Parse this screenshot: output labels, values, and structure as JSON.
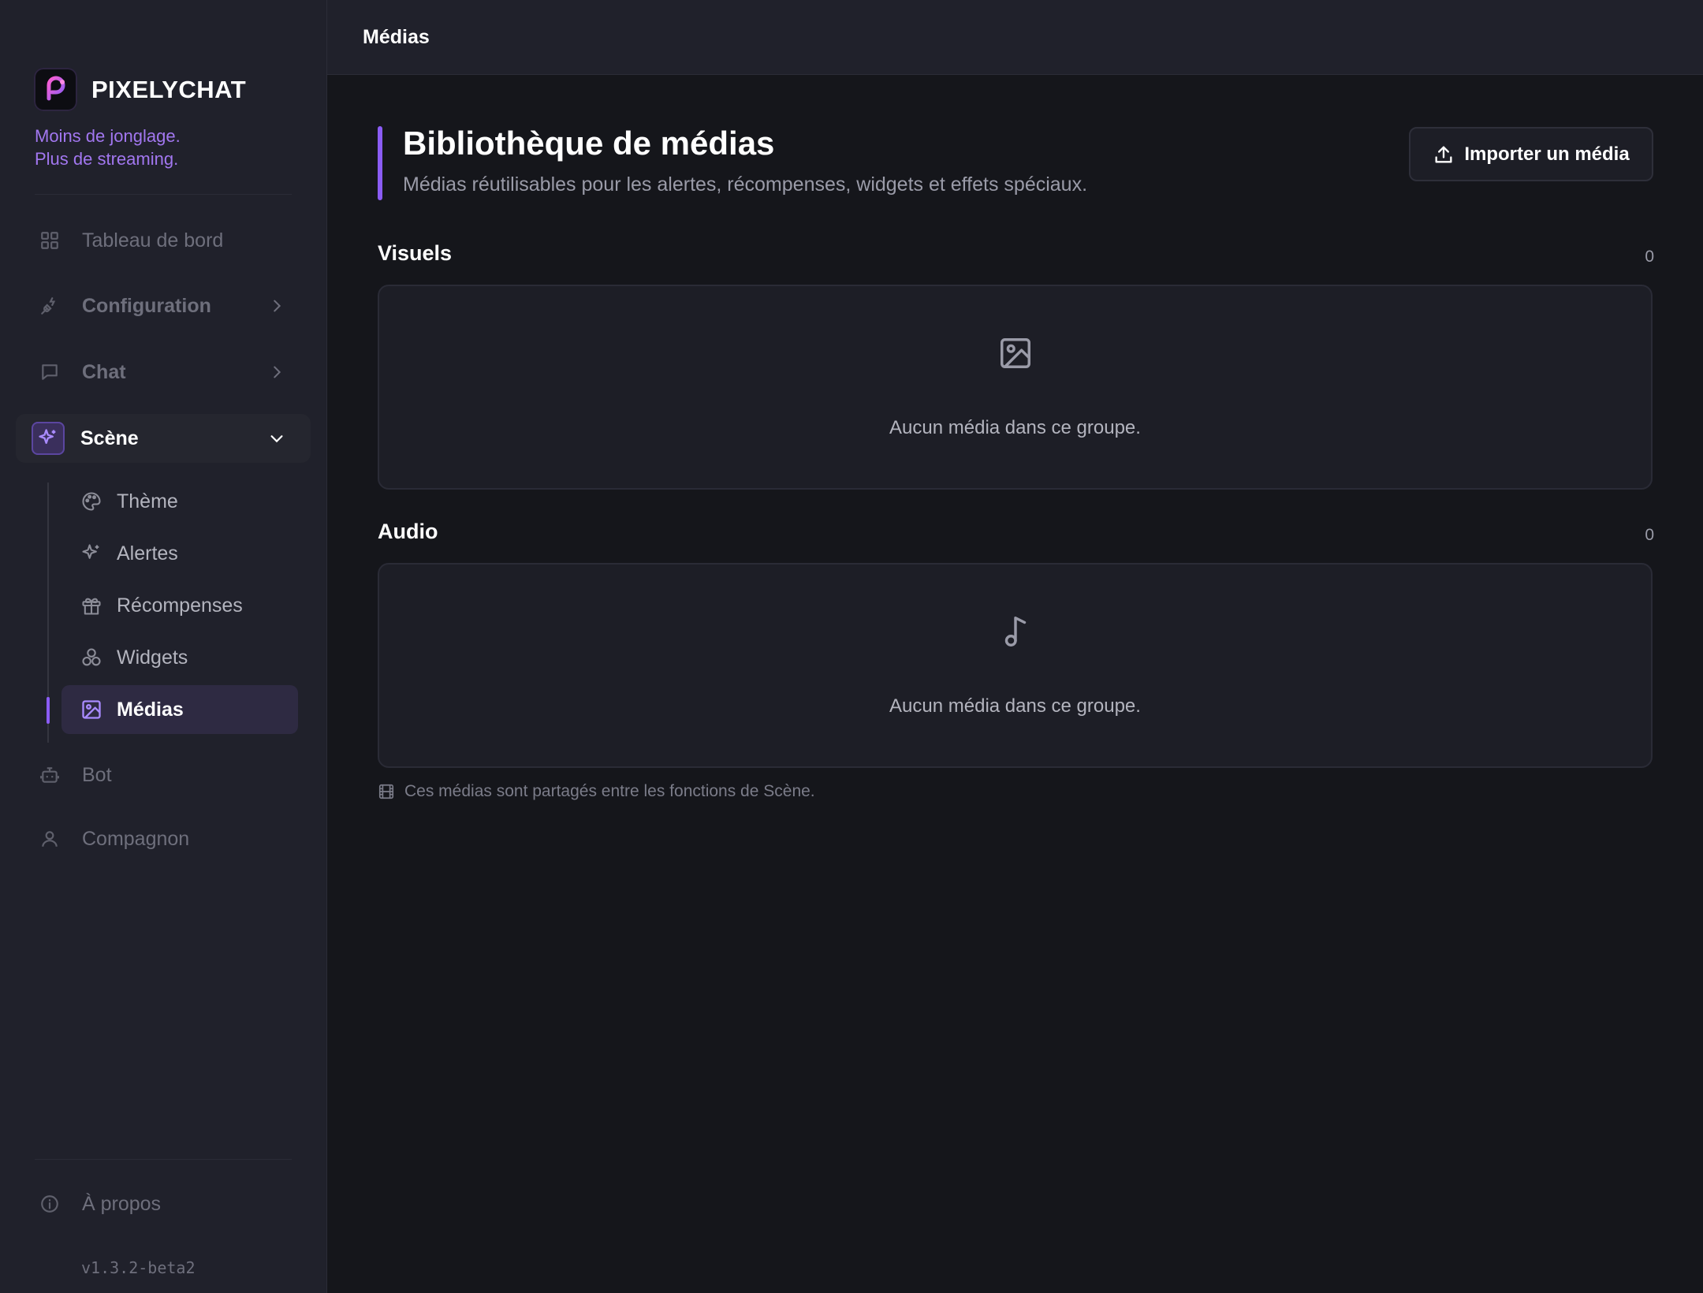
{
  "sidebar": {
    "brand_name": "PIXELYCHAT",
    "tagline_line1": "Moins de jonglage.",
    "tagline_line2": "Plus de streaming.",
    "items": [
      {
        "label": "Tableau de bord",
        "icon": "grid-icon"
      },
      {
        "label": "Configuration",
        "icon": "plug-icon"
      },
      {
        "label": "Chat",
        "icon": "message-icon"
      },
      {
        "label": "Scène",
        "icon": "sparkles-icon",
        "expanded": true
      },
      {
        "label": "Bot",
        "icon": "bot-icon"
      },
      {
        "label": "Compagnon",
        "icon": "user-icon"
      }
    ],
    "scene_sub_items": [
      {
        "label": "Thème",
        "icon": "palette-icon"
      },
      {
        "label": "Alertes",
        "icon": "sparkles-icon"
      },
      {
        "label": "Récompenses",
        "icon": "gift-icon"
      },
      {
        "label": "Widgets",
        "icon": "shapes-icon"
      },
      {
        "label": "Médias",
        "icon": "image-icon",
        "active": true
      }
    ],
    "about_label": "À propos",
    "version": "v1.3.2-beta2"
  },
  "topbar": {
    "title": "Médias"
  },
  "page": {
    "title": "Bibliothèque de médias",
    "subtitle": "Médias réutilisables pour les alertes, récompenses, widgets et effets spéciaux.",
    "import_label": "Importer un média"
  },
  "sections": [
    {
      "title": "Visuels",
      "count": "0",
      "empty_text": "Aucun média dans ce groupe.",
      "icon": "image-icon"
    },
    {
      "title": "Audio",
      "count": "0",
      "empty_text": "Aucun média dans ce groupe.",
      "icon": "music-note-icon"
    }
  ],
  "footnote": "Ces médias sont partagés entre les fonctions de Scène.",
  "colors": {
    "accent": "#8b5cf6",
    "background": "#15161b",
    "sidebar": "#20212b"
  }
}
